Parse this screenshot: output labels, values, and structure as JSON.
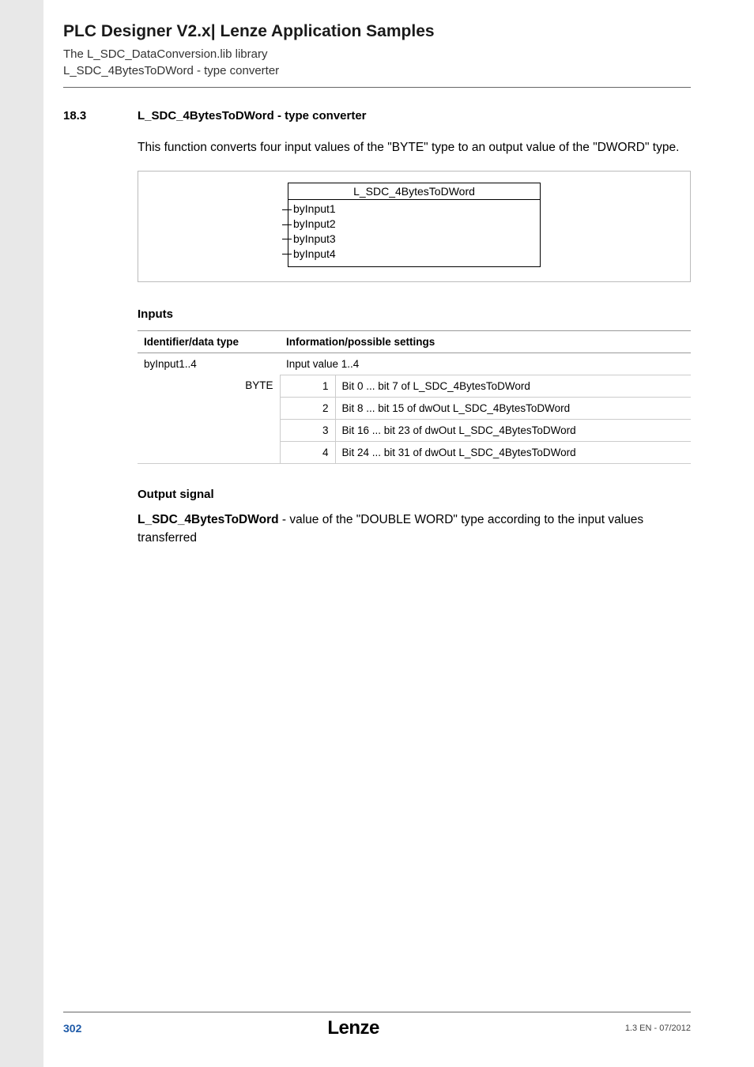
{
  "header": {
    "title": "PLC Designer V2.x| Lenze Application Samples",
    "sub1": "The L_SDC_DataConversion.lib library",
    "sub2": "L_SDC_4BytesToDWord - type converter"
  },
  "section": {
    "num": "18.3",
    "title": "L_SDC_4BytesToDWord - type converter",
    "intro": "This function converts four input values of the \"BYTE\" type to an output value of the \"DWORD\" type."
  },
  "diagram": {
    "fb_title": "L_SDC_4BytesToDWord",
    "inputs": [
      "byInput1",
      "byInput2",
      "byInput3",
      "byInput4"
    ]
  },
  "inputs_section": {
    "heading": "Inputs",
    "col1": "Identifier/data type",
    "col2": "Information/possible settings",
    "ident": "byInput1..4",
    "dtype": "BYTE",
    "info_head": "Input value 1..4",
    "rows": [
      {
        "n": "1",
        "d": "Bit 0 ... bit 7 of L_SDC_4BytesToDWord"
      },
      {
        "n": "2",
        "d": "Bit 8 ... bit 15 of dwOut L_SDC_4BytesToDWord"
      },
      {
        "n": "3",
        "d": "Bit 16 ... bit 23 of dwOut L_SDC_4BytesToDWord"
      },
      {
        "n": "4",
        "d": "Bit 24 ... bit 31 of dwOut L_SDC_4BytesToDWord"
      }
    ]
  },
  "output_section": {
    "heading": "Output signal",
    "bold": "L_SDC_4BytesToDWord",
    "rest": " - value of the \"DOUBLE WORD\" type according to the input values transferred"
  },
  "footer": {
    "page": "302",
    "logo": "Lenze",
    "ver": "1.3 EN - 07/2012"
  }
}
